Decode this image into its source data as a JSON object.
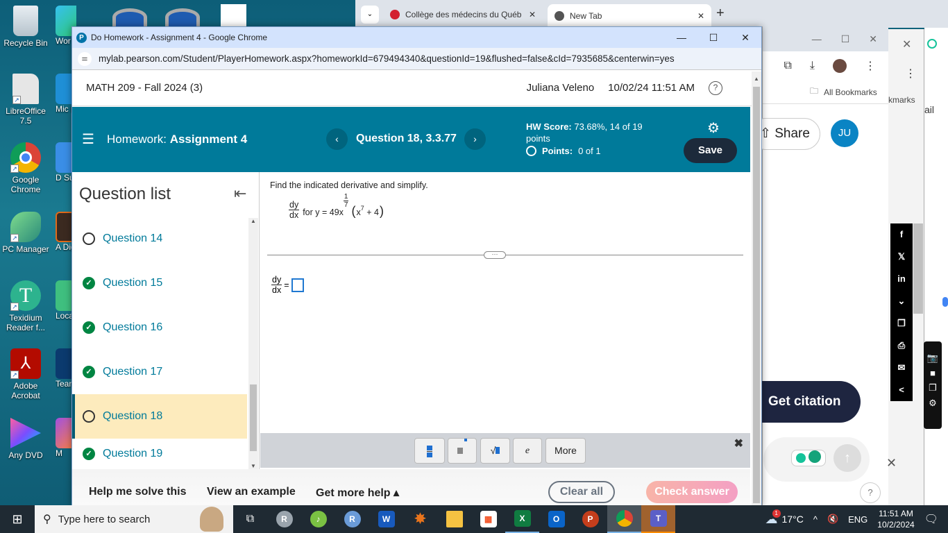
{
  "desktop": {
    "icons": [
      {
        "label": "Recycle Bin",
        "icon": "recycle-bin-icon"
      },
      {
        "label": "LibreOffice 7.5",
        "icon": "libreoffice-icon"
      },
      {
        "label": "Google Chrome",
        "icon": "chrome-icon"
      },
      {
        "label": "PC Manager",
        "icon": "pc-manager-icon"
      },
      {
        "label": "Texidium Reader f...",
        "icon": "texidium-icon"
      },
      {
        "label": "Adobe Acrobat",
        "icon": "acrobat-icon"
      },
      {
        "label": "Any DVD",
        "icon": "anydvd-icon"
      }
    ],
    "partial_icons": [
      "Wor",
      "Mic E",
      "D Supp",
      "A Digi",
      "Loca",
      "Tean",
      "M"
    ]
  },
  "background_browser": {
    "tabs": [
      {
        "label": "Collège des médecins du Québ",
        "icon": "cmq-icon"
      },
      {
        "label": "New Tab",
        "icon": "chrome-icon"
      }
    ],
    "new_tab_label": "+",
    "bookmarks_label": "All Bookmarks",
    "bookmarks_partial": "kmarks",
    "partial_text": "ail",
    "share_label": "Share",
    "avatar_initials": "JU",
    "get_citation_label": "Get citation",
    "social_icons": [
      "f",
      "𝕏",
      "in",
      "⌄",
      "❐",
      "⎙",
      "✉",
      "<"
    ],
    "help_label": "?"
  },
  "window": {
    "title": "Do Homework - Assignment 4 - Google Chrome",
    "url": "mylab.pearson.com/Student/PlayerHomework.aspx?homeworkId=679494340&questionId=19&flushed=false&cId=7935685&centerwin=yes"
  },
  "course": {
    "name": "MATH 209 - Fall 2024 (3)",
    "user": "Juliana Veleno",
    "datetime": "10/02/24 11:51 AM",
    "help_icon": "?"
  },
  "homework": {
    "prefix": "Homework:",
    "name": "Assignment 4",
    "question_label": "Question 18, 3.3.77",
    "hw_score_label": "HW Score:",
    "hw_score_value": "73.68%, 14 of 19 points",
    "points_label": "Points:",
    "points_value": "0 of 1",
    "save_label": "Save"
  },
  "question_list": {
    "title": "Question list",
    "items": [
      {
        "label": "Question 14",
        "status": "open",
        "active": false
      },
      {
        "label": "Question 15",
        "status": "done",
        "active": false
      },
      {
        "label": "Question 16",
        "status": "done",
        "active": false
      },
      {
        "label": "Question 17",
        "status": "done",
        "active": false
      },
      {
        "label": "Question 18",
        "status": "open",
        "active": true
      },
      {
        "label": "Question 19",
        "status": "done",
        "active": false
      }
    ]
  },
  "question": {
    "prompt": "Find the indicated derivative and simplify.",
    "dy": "dy",
    "dx": "dx",
    "for_text": "for y = 49x",
    "exp_num": "1",
    "exp_den": "7",
    "paren_open": "(",
    "inner_x": "x",
    "inner_exp": "7",
    "inner_rest": " + 4",
    "paren_close": ")",
    "equals": "=",
    "answer_value": ""
  },
  "math_palette": {
    "buttons": [
      "fraction",
      "exponent",
      "sqrt",
      "e",
      "More"
    ],
    "e_label": "e",
    "more_label": "More",
    "close": "✖"
  },
  "footer": {
    "help_me_solve": "Help me solve this",
    "view_example": "View an example",
    "get_more_help": "Get more help ▴",
    "clear_all": "Clear all",
    "check_answer": "Check answer"
  },
  "taskbar": {
    "search_placeholder": "Type here to search",
    "weather": "17°C",
    "weather_badge": "1",
    "language": "ENG",
    "time": "11:51 AM",
    "date": "10/2/2024"
  }
}
